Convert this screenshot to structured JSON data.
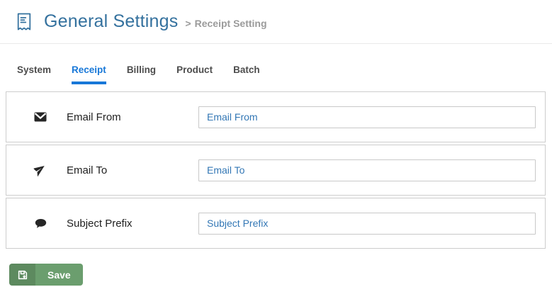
{
  "header": {
    "icon": "receipt-icon",
    "title": "General Settings",
    "breadcrumb_separator": ">",
    "breadcrumb": "Receipt Setting"
  },
  "tabs": [
    {
      "label": "System",
      "active": false
    },
    {
      "label": "Receipt",
      "active": true
    },
    {
      "label": "Billing",
      "active": false
    },
    {
      "label": "Product",
      "active": false
    },
    {
      "label": "Batch",
      "active": false
    }
  ],
  "form": {
    "rows": [
      {
        "icon": "envelope-icon",
        "label": "Email From",
        "value": "Email From"
      },
      {
        "icon": "paper-plane-icon",
        "label": "Email To",
        "value": "Email To"
      },
      {
        "icon": "comment-icon",
        "label": "Subject Prefix",
        "value": "Subject Prefix"
      }
    ]
  },
  "save_button": {
    "icon": "floppy-save-icon",
    "label": "Save"
  },
  "colors": {
    "title_blue": "#34719e",
    "active_tab_blue": "#1878d8",
    "input_text_blue": "#3377b5",
    "save_green": "#6b9e6e",
    "save_green_dark": "#5d8a5f",
    "border_gray": "#cdcdcd"
  }
}
